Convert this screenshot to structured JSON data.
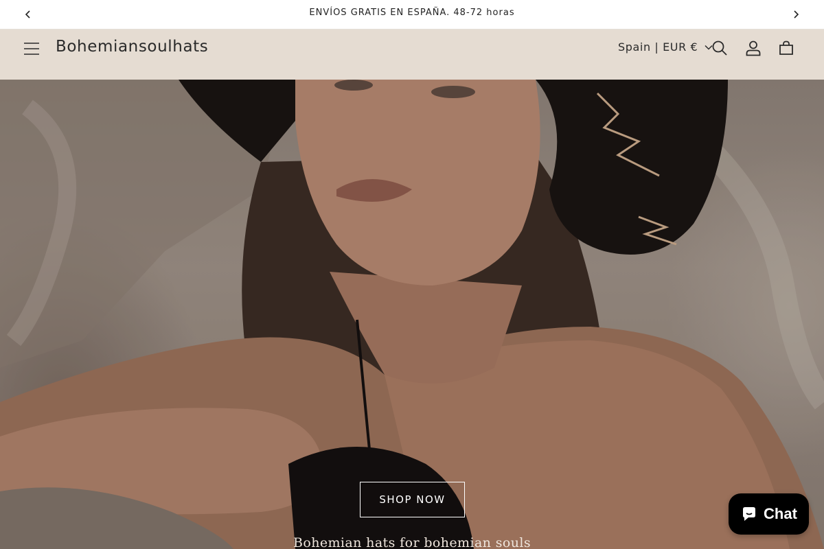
{
  "announcement": {
    "text": "ENVÍOS GRATIS EN ESPAÑA. 48-72 horas",
    "prev_icon": "chevron-left-icon",
    "next_icon": "chevron-right-icon"
  },
  "header": {
    "logo": "Bohemiansoulhats",
    "country_selector": "Spain | EUR €",
    "icons": [
      "menu-icon",
      "search-icon",
      "account-icon",
      "cart-icon"
    ]
  },
  "hero": {
    "button_label": "SHOP NOW",
    "tagline": "Bohemian hats for bohemian souls"
  },
  "chat": {
    "label": "Chat",
    "icon": "chat-bubble-icon"
  },
  "colors": {
    "header_bg": "#e5dcd2",
    "announcement_bg": "#ffffff",
    "chat_bg": "#000000",
    "text": "#2a2a2a"
  }
}
